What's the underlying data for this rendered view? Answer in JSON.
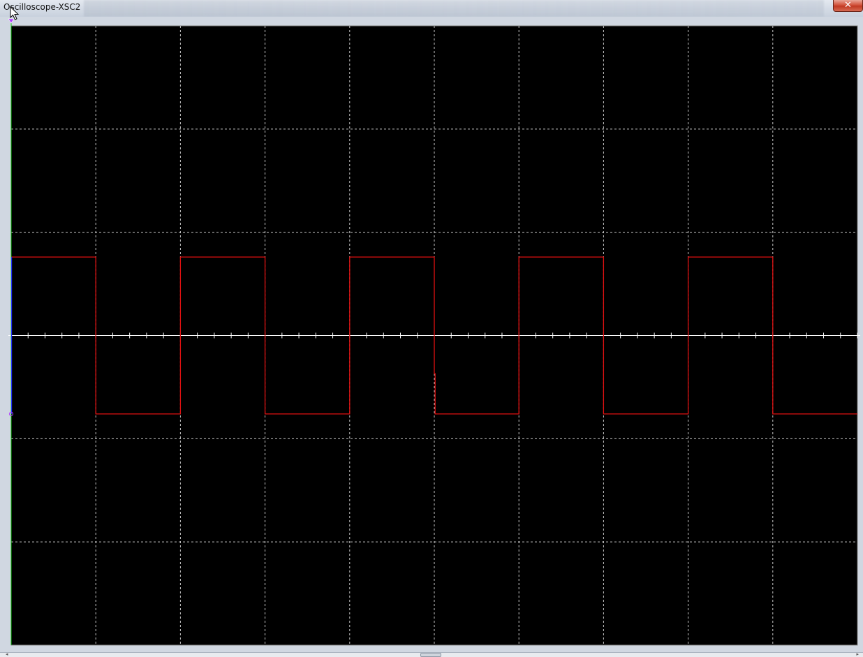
{
  "window": {
    "title": "Oscilloscope-XSC2",
    "close_glyph": "✕"
  },
  "icons": {
    "close": "close-icon",
    "cursor": "mouse-pointer-icon",
    "trigger_marker": "trigger-marker-icon",
    "channel_marker": "channel-a-ground-marker-icon"
  },
  "colors": {
    "screen_background": "#000000",
    "grid": "#c8c8c8",
    "axis": "#ffffff",
    "channel_a_trace": "#e01010",
    "time_cursor_1": "#18c818",
    "time_cursor_2": "#2030ff",
    "marker": "#b040ff"
  },
  "chart_data": {
    "type": "line",
    "divisions": {
      "x": 10,
      "y": 6
    },
    "minor_ticks_per_division": 5,
    "xlim": [
      0,
      10
    ],
    "ylim": [
      -3,
      3
    ],
    "series": [
      {
        "x": [
          0,
          1,
          1,
          2,
          2,
          3,
          3,
          4,
          4,
          5,
          5,
          5.01,
          5.01,
          6,
          6,
          7,
          7,
          8,
          8,
          9,
          9,
          10
        ],
        "y": [
          0.76,
          0.76,
          -0.76,
          -0.76,
          0.76,
          0.76,
          -0.76,
          -0.76,
          0.76,
          0.76,
          -0.37,
          -0.37,
          -0.76,
          -0.76,
          0.76,
          0.76,
          -0.76,
          -0.76,
          0.76,
          0.76,
          -0.76,
          -0.76
        ]
      }
    ],
    "time_cursors": [
      0,
      0
    ],
    "grid": true,
    "legend": "none"
  }
}
